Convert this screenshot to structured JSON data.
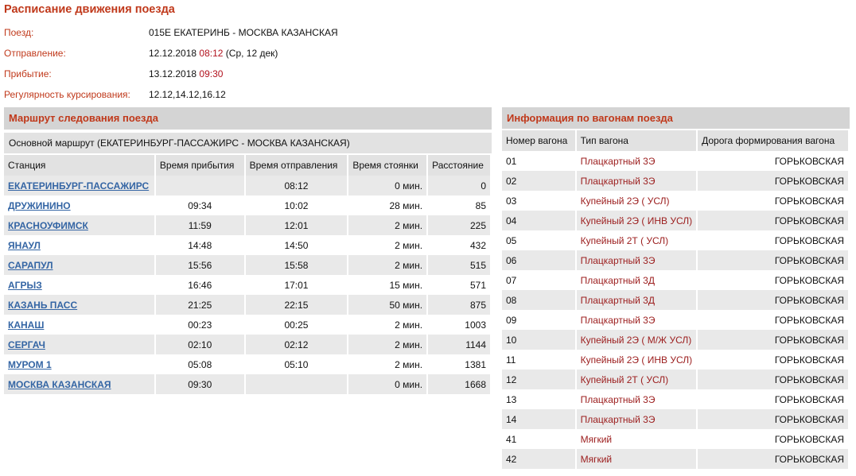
{
  "title": "Расписание движения поезда",
  "train": {
    "label_train": "Поезд:",
    "train_value": "015Е ЕКАТЕРИНБ - МОСКВА КАЗАНСКАЯ",
    "label_departure": "Отправление:",
    "departure_date": "12.12.2018",
    "departure_time": "08:12",
    "departure_note": "(Ср, 12 дек)",
    "label_arrival": "Прибытие:",
    "arrival_date": "13.12.2018",
    "arrival_time": "09:30",
    "label_regularity": "Регулярность курсирования:",
    "regularity_value": "12.12,14.12,16.12"
  },
  "route": {
    "title": "Маршрут следования поезда",
    "main_route": "Основной маршрут (ЕКАТЕРИНБУРГ-ПАССАЖИРС - МОСКВА КАЗАНСКАЯ)",
    "columns": [
      "Станция",
      "Время прибытия",
      "Время отправления",
      "Время стоянки",
      "Расстояние"
    ],
    "rows": [
      {
        "station": "ЕКАТЕРИНБУРГ-ПАССАЖИРС",
        "arrival": "",
        "departure": "08:12",
        "stop": "0 мин.",
        "distance": "0"
      },
      {
        "station": "ДРУЖИНИНО",
        "arrival": "09:34",
        "departure": "10:02",
        "stop": "28 мин.",
        "distance": "85"
      },
      {
        "station": "КРАСНОУФИМСК",
        "arrival": "11:59",
        "departure": "12:01",
        "stop": "2 мин.",
        "distance": "225"
      },
      {
        "station": "ЯНАУЛ",
        "arrival": "14:48",
        "departure": "14:50",
        "stop": "2 мин.",
        "distance": "432"
      },
      {
        "station": "САРАПУЛ",
        "arrival": "15:56",
        "departure": "15:58",
        "stop": "2 мин.",
        "distance": "515"
      },
      {
        "station": "АГРЫЗ",
        "arrival": "16:46",
        "departure": "17:01",
        "stop": "15 мин.",
        "distance": "571"
      },
      {
        "station": "КАЗАНЬ ПАСС",
        "arrival": "21:25",
        "departure": "22:15",
        "stop": "50 мин.",
        "distance": "875"
      },
      {
        "station": "КАНАШ",
        "arrival": "00:23",
        "departure": "00:25",
        "stop": "2 мин.",
        "distance": "1003"
      },
      {
        "station": "СЕРГАЧ",
        "arrival": "02:10",
        "departure": "02:12",
        "stop": "2 мин.",
        "distance": "1144"
      },
      {
        "station": "МУРОМ 1",
        "arrival": "05:08",
        "departure": "05:10",
        "stop": "2 мин.",
        "distance": "1381"
      },
      {
        "station": "МОСКВА КАЗАНСКАЯ",
        "arrival": "09:30",
        "departure": "",
        "stop": "0 мин.",
        "distance": "1668"
      }
    ]
  },
  "wagons": {
    "title": "Информация по вагонам поезда",
    "columns": [
      "Номер вагона",
      "Тип вагона",
      "Дорога формирования вагона"
    ],
    "rows": [
      {
        "num": "01",
        "type": "Плацкартный 3Э",
        "road": "ГОРЬКОВСКАЯ"
      },
      {
        "num": "02",
        "type": "Плацкартный 3Э",
        "road": "ГОРЬКОВСКАЯ"
      },
      {
        "num": "03",
        "type": "Купейный 2Э ( УСЛ)",
        "road": "ГОРЬКОВСКАЯ"
      },
      {
        "num": "04",
        "type": "Купейный 2Э ( ИНВ УСЛ)",
        "road": "ГОРЬКОВСКАЯ"
      },
      {
        "num": "05",
        "type": "Купейный 2Т ( УСЛ)",
        "road": "ГОРЬКОВСКАЯ"
      },
      {
        "num": "06",
        "type": "Плацкартный 3Э",
        "road": "ГОРЬКОВСКАЯ"
      },
      {
        "num": "07",
        "type": "Плацкартный 3Д",
        "road": "ГОРЬКОВСКАЯ"
      },
      {
        "num": "08",
        "type": "Плацкартный 3Д",
        "road": "ГОРЬКОВСКАЯ"
      },
      {
        "num": "09",
        "type": "Плацкартный 3Э",
        "road": "ГОРЬКОВСКАЯ"
      },
      {
        "num": "10",
        "type": "Купейный 2Э ( М/Ж УСЛ)",
        "road": "ГОРЬКОВСКАЯ"
      },
      {
        "num": "11",
        "type": "Купейный 2Э ( ИНВ УСЛ)",
        "road": "ГОРЬКОВСКАЯ"
      },
      {
        "num": "12",
        "type": "Купейный 2Т ( УСЛ)",
        "road": "ГОРЬКОВСКАЯ"
      },
      {
        "num": "13",
        "type": "Плацкартный 3Э",
        "road": "ГОРЬКОВСКАЯ"
      },
      {
        "num": "14",
        "type": "Плацкартный 3Э",
        "road": "ГОРЬКОВСКАЯ"
      },
      {
        "num": "41",
        "type": "Мягкий",
        "road": "ГОРЬКОВСКАЯ"
      },
      {
        "num": "42",
        "type": "Мягкий",
        "road": "ГОРЬКОВСКАЯ"
      }
    ]
  },
  "colors": {
    "accent": "#c0391b",
    "link": "#3465a4",
    "wagon_type": "#9b1c1c",
    "header_bg": "#d4d4d4",
    "stripe": "#e9e9e9"
  }
}
